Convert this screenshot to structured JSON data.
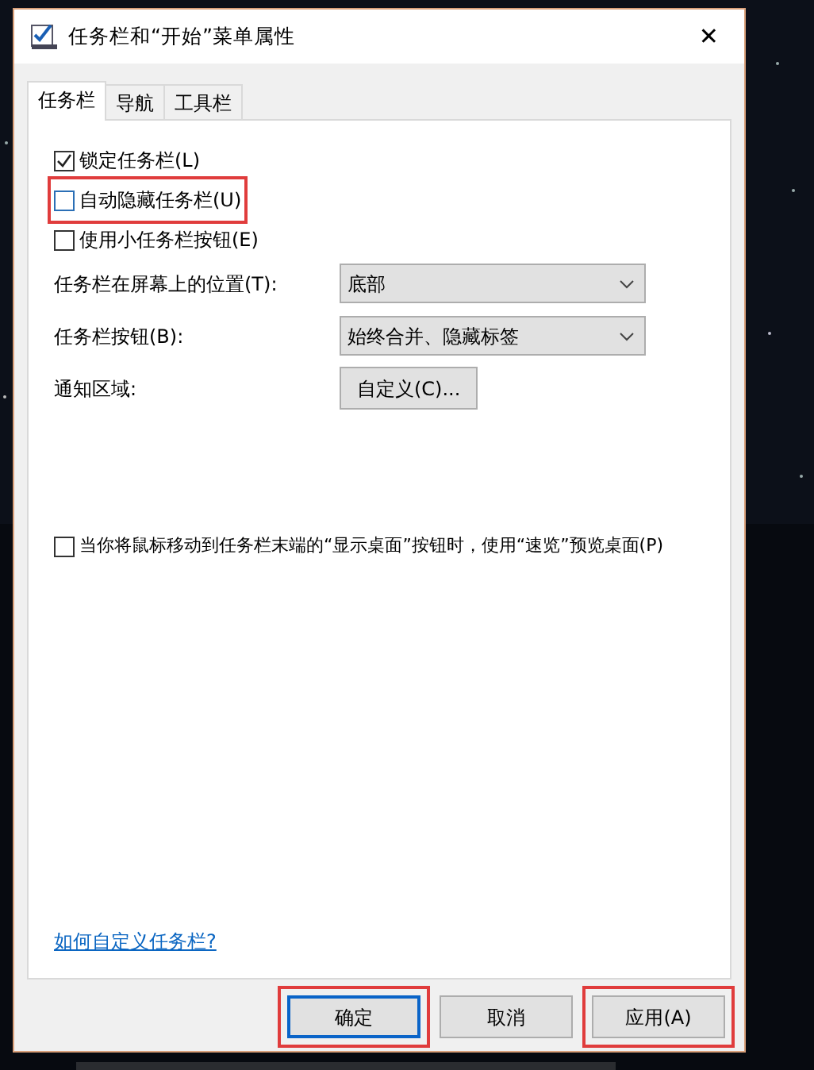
{
  "window": {
    "title": "任务栏和“开始”菜单属性",
    "close": "✕"
  },
  "tabs": [
    {
      "label": "任务栏",
      "selected": true
    },
    {
      "label": "导航",
      "selected": false
    },
    {
      "label": "工具栏",
      "selected": false
    }
  ],
  "options": [
    {
      "kind": "checkbox",
      "label": "锁定任务栏(L)",
      "checked": true,
      "highlighted": false
    },
    {
      "kind": "checkbox",
      "label": "自动隐藏任务栏(U)",
      "checked": false,
      "highlighted": true
    },
    {
      "kind": "checkbox",
      "label": "使用小任务栏按钮(E)",
      "checked": false,
      "highlighted": false
    },
    {
      "kind": "select",
      "label": "任务栏在屏幕上的位置(T):",
      "value": "底部"
    },
    {
      "kind": "select",
      "label": "任务栏按钮(B):",
      "value": "始终合并、隐藏标签"
    },
    {
      "kind": "button",
      "label": "通知区域:",
      "value": "自定义(C)..."
    },
    {
      "kind": "spacer"
    },
    {
      "kind": "checkbox",
      "label": "当你将鼠标移动到任务栏末端的“显示桌面”按钮时，使用“速览”预览桌面(P)",
      "checked": false,
      "highlighted": false
    }
  ],
  "help_link": "如何自定义任务栏?",
  "buttons": [
    {
      "label": "确定",
      "default": true,
      "highlighted": true
    },
    {
      "label": "取消",
      "default": false,
      "highlighted": false
    },
    {
      "label": "应用(A)",
      "default": false,
      "highlighted": true
    }
  ]
}
